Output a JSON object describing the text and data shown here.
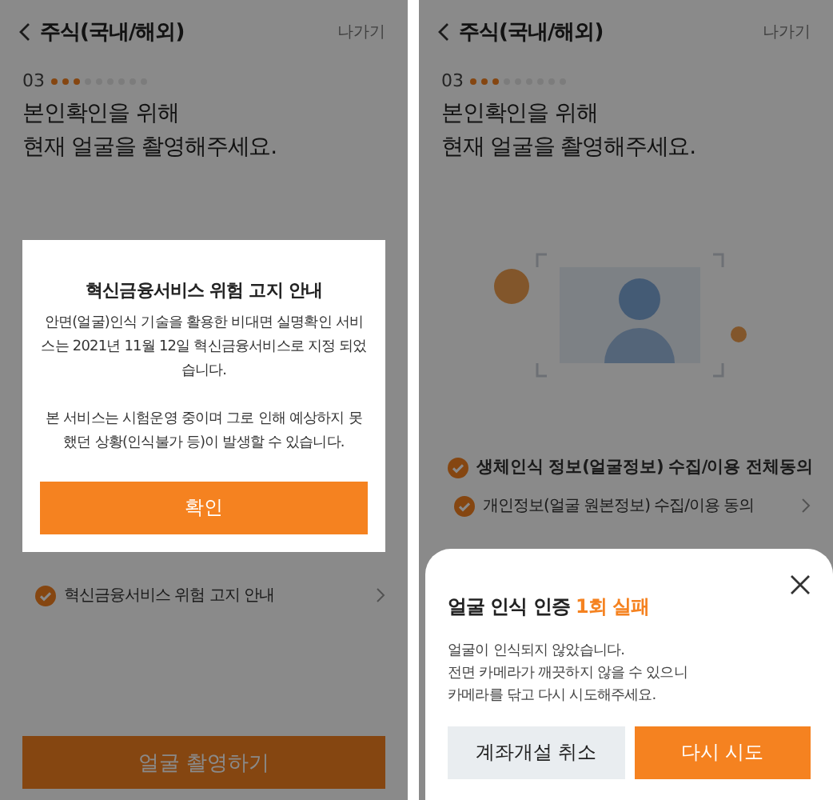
{
  "screens": [
    {
      "header": {
        "title": "주식(국내/해외)",
        "exit": "나가기"
      },
      "step": {
        "number": "03",
        "dots": [
          {
            "done": true
          },
          {
            "done": true
          },
          {
            "done": true
          },
          {
            "done": false
          },
          {
            "done": false
          },
          {
            "done": false
          },
          {
            "done": false
          },
          {
            "done": false
          },
          {
            "done": false
          }
        ]
      },
      "heading": [
        "본인확인을 위해",
        "현재 얼굴을 촬영해주세요."
      ],
      "agreements": [
        {
          "kind": "sub",
          "label": "혁신금융서비스 위험 고지 안내",
          "checked": true
        }
      ],
      "bottom_button": "얼굴 촬영하기",
      "dialog": {
        "kind": "modal",
        "title": "혁신금융서비스 위험 고지 안내",
        "paragraphs": [
          "안면(얼굴)인식 기술을 활용한 비대면 실명확인 서비스는 2021년 11월 12일 혁신금융서비스로 지정 되었습니다.",
          "본 서비스는 시험운영 중이며 그로 인해 예상하지 못했던 상황(인식불가 등)이 발생할 수 있습니다."
        ],
        "buttons": [
          {
            "kind": "primary",
            "label": "확인"
          }
        ]
      }
    },
    {
      "header": {
        "title": "주식(국내/해외)",
        "exit": "나가기"
      },
      "step": {
        "number": "03",
        "dots": [
          {
            "done": true
          },
          {
            "done": true
          },
          {
            "done": true
          },
          {
            "done": false
          },
          {
            "done": false
          },
          {
            "done": false
          },
          {
            "done": false
          },
          {
            "done": false
          },
          {
            "done": false
          }
        ]
      },
      "heading": [
        "본인확인을 위해",
        "현재 얼굴을 촬영해주세요."
      ],
      "illustration": true,
      "agreements": [
        {
          "kind": "all",
          "label": "생체인식 정보(얼굴정보) 수집/이용 전체동의",
          "checked": true
        },
        {
          "kind": "sub",
          "label": "개인정보(얼굴 원본정보) 수집/이용 동의",
          "checked": true
        }
      ],
      "dialog": {
        "kind": "sheet",
        "title": "얼굴 인식 인증",
        "title_highlight": "1회 실패",
        "paragraphs": [
          "얼굴이 인식되지 않았습니다.\n전면 카메라가 깨끗하지 않을 수 있으니\n카메라를 닦고 다시 시도해주세요."
        ],
        "buttons": [
          {
            "kind": "secondary",
            "label": "계좌개설 취소"
          },
          {
            "kind": "primary",
            "label": "다시 시도"
          }
        ]
      }
    }
  ]
}
